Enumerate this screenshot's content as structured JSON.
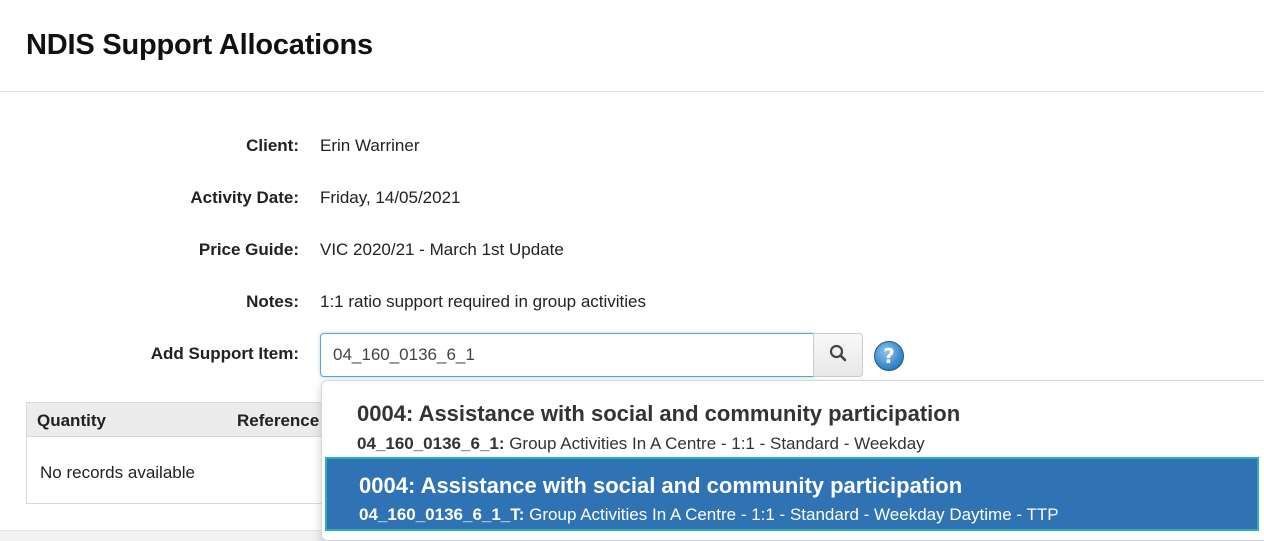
{
  "page": {
    "title": "NDIS Support Allocations"
  },
  "details": {
    "client_label": "Client:",
    "client_value": "Erin Warriner",
    "activity_date_label": "Activity Date:",
    "activity_date_value": "Friday, 14/05/2021",
    "price_guide_label": "Price Guide:",
    "price_guide_value": "VIC 2020/21 - March 1st Update",
    "notes_label": "Notes:",
    "notes_value": "1:1 ratio support required in group activities"
  },
  "support_item": {
    "label": "Add Support Item:",
    "value": "04_160_0136_6_1",
    "search_icon": "search-icon",
    "help_icon": "help-icon",
    "help_glyph": "?"
  },
  "grid": {
    "columns": [
      "Quantity",
      "Reference"
    ],
    "empty_text": "No records available"
  },
  "dropdown": {
    "items": [
      {
        "title": "0004: Assistance with social and community participation",
        "code": "04_160_0136_6_1:",
        "description": " Group Activities In A Centre - 1:1 - Standard - Weekday",
        "selected": false
      },
      {
        "title": "0004: Assistance with social and community participation",
        "code": "04_160_0136_6_1_T:",
        "description": " Group Activities In A Centre - 1:1 - Standard - Weekday Daytime - TTP",
        "selected": true
      }
    ]
  },
  "colors": {
    "selected_bg": "#2f73b5",
    "selected_border": "#2bb0b8",
    "focus_border": "#5aa7d6"
  }
}
